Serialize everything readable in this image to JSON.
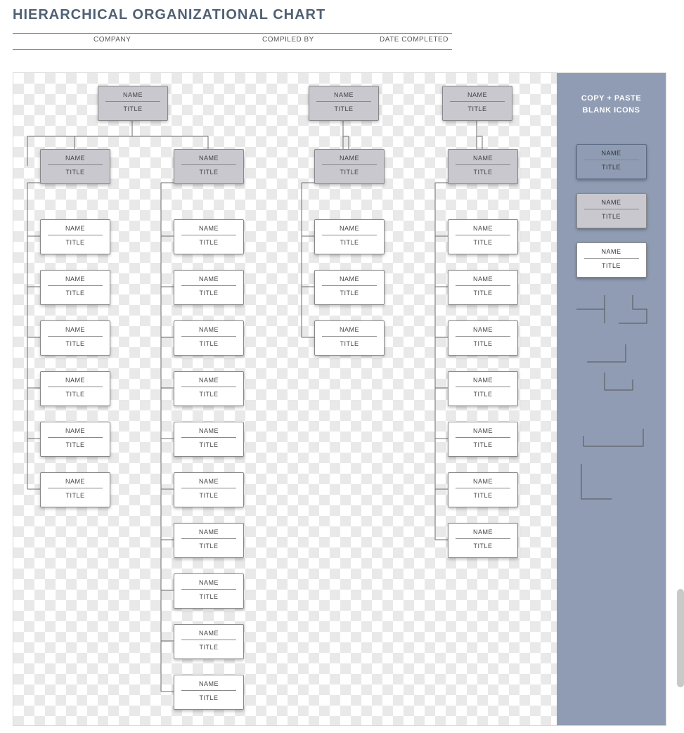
{
  "header": {
    "title": "HIERARCHICAL ORGANIZATIONAL CHART"
  },
  "meta": {
    "company": "COMPANY",
    "compiled_by": "COMPILED BY",
    "date_completed": "DATE COMPLETED"
  },
  "labels": {
    "name": "NAME",
    "title": "TITLE"
  },
  "sidebar": {
    "heading1": "COPY + PASTE",
    "heading2": "BLANK ICONS",
    "icons": [
      {
        "variant": "blue",
        "name": "NAME",
        "title": "TITLE"
      },
      {
        "variant": "dark",
        "name": "NAME",
        "title": "TITLE"
      },
      {
        "variant": "white",
        "name": "NAME",
        "title": "TITLE"
      }
    ]
  },
  "chart_data": {
    "type": "org-chart",
    "columns": [
      {
        "id": "col1",
        "top": {
          "name": "NAME",
          "title": "TITLE",
          "variant": "dark"
        },
        "second": {
          "name": "NAME",
          "title": "TITLE",
          "variant": "dark"
        },
        "children": [
          {
            "name": "NAME",
            "title": "TITLE"
          },
          {
            "name": "NAME",
            "title": "TITLE"
          },
          {
            "name": "NAME",
            "title": "TITLE"
          },
          {
            "name": "NAME",
            "title": "TITLE"
          },
          {
            "name": "NAME",
            "title": "TITLE"
          },
          {
            "name": "NAME",
            "title": "TITLE"
          }
        ]
      },
      {
        "id": "col2",
        "second": {
          "name": "NAME",
          "title": "TITLE",
          "variant": "dark"
        },
        "children": [
          {
            "name": "NAME",
            "title": "TITLE"
          },
          {
            "name": "NAME",
            "title": "TITLE"
          },
          {
            "name": "NAME",
            "title": "TITLE"
          },
          {
            "name": "NAME",
            "title": "TITLE"
          },
          {
            "name": "NAME",
            "title": "TITLE"
          },
          {
            "name": "NAME",
            "title": "TITLE"
          },
          {
            "name": "NAME",
            "title": "TITLE"
          },
          {
            "name": "NAME",
            "title": "TITLE"
          },
          {
            "name": "NAME",
            "title": "TITLE"
          },
          {
            "name": "NAME",
            "title": "TITLE"
          }
        ]
      },
      {
        "id": "col3",
        "top": {
          "name": "NAME",
          "title": "TITLE",
          "variant": "dark"
        },
        "second": {
          "name": "NAME",
          "title": "TITLE",
          "variant": "dark"
        },
        "children": [
          {
            "name": "NAME",
            "title": "TITLE"
          },
          {
            "name": "NAME",
            "title": "TITLE"
          },
          {
            "name": "NAME",
            "title": "TITLE"
          }
        ]
      },
      {
        "id": "col4",
        "top": {
          "name": "NAME",
          "title": "TITLE",
          "variant": "dark"
        },
        "second": {
          "name": "NAME",
          "title": "TITLE",
          "variant": "dark"
        },
        "children": [
          {
            "name": "NAME",
            "title": "TITLE"
          },
          {
            "name": "NAME",
            "title": "TITLE"
          },
          {
            "name": "NAME",
            "title": "TITLE"
          },
          {
            "name": "NAME",
            "title": "TITLE"
          },
          {
            "name": "NAME",
            "title": "TITLE"
          },
          {
            "name": "NAME",
            "title": "TITLE"
          },
          {
            "name": "NAME",
            "title": "TITLE"
          }
        ]
      }
    ]
  }
}
